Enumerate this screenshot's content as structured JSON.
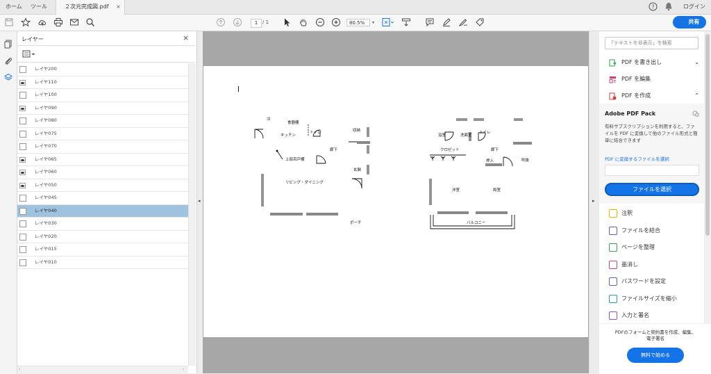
{
  "tabs": {
    "home": "ホーム",
    "tools": "ツール",
    "doc": "２次元完成図.pdf",
    "close": "×"
  },
  "header": {
    "login": "ログイン"
  },
  "toolbar": {
    "page_current": "1",
    "page_total": "/ 1",
    "zoom": "80.5%",
    "share": "共有"
  },
  "layers": {
    "title": "レイヤー",
    "close": "×",
    "items": [
      {
        "label": "レイヤ200",
        "eye": false
      },
      {
        "label": "レイヤ110",
        "eye": true
      },
      {
        "label": "レイヤ100",
        "eye": false
      },
      {
        "label": "レイヤ090",
        "eye": true
      },
      {
        "label": "レイヤ080",
        "eye": false
      },
      {
        "label": "レイヤ075",
        "eye": false
      },
      {
        "label": "レイヤ070",
        "eye": false
      },
      {
        "label": "レイヤ065",
        "eye": true
      },
      {
        "label": "レイヤ060",
        "eye": true
      },
      {
        "label": "レイヤ050",
        "eye": true
      },
      {
        "label": "レイヤ045",
        "eye": false
      },
      {
        "label": "レイヤ040",
        "eye": false,
        "selected": true
      },
      {
        "label": "レイヤ030",
        "eye": false
      },
      {
        "label": "レイヤ020",
        "eye": false
      },
      {
        "label": "レイヤ015",
        "eye": false
      },
      {
        "label": "レイヤ010",
        "eye": false
      }
    ]
  },
  "floorplan": {
    "left": {
      "label_1": "冷",
      "label_2": "食器棚",
      "label_3": "キッチン",
      "label_4": "トイレ",
      "label_5": "収納",
      "label_6": "廊下",
      "label_7": "上部吊戸棚",
      "label_8": "玄関",
      "label_9": "リビング・ダイニング",
      "label_10": "ポーチ"
    },
    "right": {
      "label_1": "浴室",
      "label_2": "洗面室",
      "label_3": "トイレ",
      "label_4": "クロゼット",
      "label_5": "廊下",
      "label_6": "押入",
      "label_7": "吹抜",
      "label_8": "洋室",
      "label_9": "和室",
      "label_10": "バルコニー"
    }
  },
  "rpanel": {
    "search_placeholder": "「テキストを非表示」を検索",
    "export_pdf": "PDF を書き出し",
    "edit_pdf": "PDF を編集",
    "create_pdf": "PDF を作成",
    "pack_title": "Adobe PDF Pack",
    "pack_desc": "有料サブスクリプションを利用すると、ファイルを PDF に変換して他のファイル形式と簡単に結合できます",
    "pack_link": "PDF に変換するファイルを選択",
    "select_file": "ファイルを選択",
    "tools": [
      {
        "label": "注釈",
        "color": "#e8b400"
      },
      {
        "label": "ファイルを結合",
        "color": "#5b5bd6"
      },
      {
        "label": "ページを整理",
        "color": "#2fa34a"
      },
      {
        "label": "墨消し",
        "color": "#d63c74"
      },
      {
        "label": "パスワードを設定",
        "color": "#5b5bd6"
      },
      {
        "label": "ファイルサイズを縮小",
        "color": "#1aa5a0"
      },
      {
        "label": "入力と署名",
        "color": "#8f4fd6"
      }
    ],
    "promo_text": "PDFのフォームと契約書を作成、編集、電子署名",
    "promo_btn": "無料で始める"
  },
  "colors": {
    "accent": "#1473e6",
    "selected_row": "#9fc3df"
  }
}
